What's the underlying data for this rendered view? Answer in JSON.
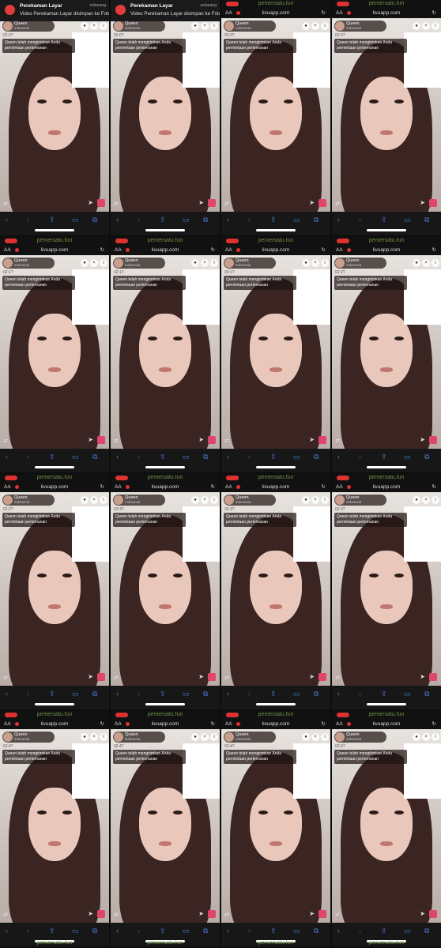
{
  "banner": {
    "title": "Perekaman Layar",
    "subtitle": "Video Perekaman Layar disimpan ke Foto",
    "when": "sekarang"
  },
  "browser": {
    "text_size": "AA",
    "url": "livuapp.com",
    "reload": "↻"
  },
  "watermark": "pemersatu.fun",
  "host": {
    "name": "Queen",
    "sub": "indonesia"
  },
  "notice": "Queen telah mengirimkan Anda permintaan pertemanan",
  "tiles": [
    {
      "time": "02:0?"
    },
    {
      "time": "02:0?"
    },
    {
      "time": "02:0?"
    },
    {
      "time": "02:0?"
    },
    {
      "time": "02:1?"
    },
    {
      "time": "02:1?"
    },
    {
      "time": "02:1?"
    },
    {
      "time": "02:2?"
    },
    {
      "time": "02:2?"
    },
    {
      "time": "02:3?"
    },
    {
      "time": "02:3?"
    },
    {
      "time": "02:3?"
    },
    {
      "time": "02:4?"
    },
    {
      "time": "02:4?"
    },
    {
      "time": "02:4?"
    },
    {
      "time": "02:5?"
    }
  ],
  "nav_icons": [
    "chevron-left-icon",
    "chevron-right-icon",
    "share-icon",
    "book-icon",
    "tabs-icon"
  ],
  "colors": {
    "accent_blue": "#4a7bd8",
    "record_red": "#e03131",
    "gift_pink": "#e0456c",
    "watermark_green": "#7ea44a"
  }
}
